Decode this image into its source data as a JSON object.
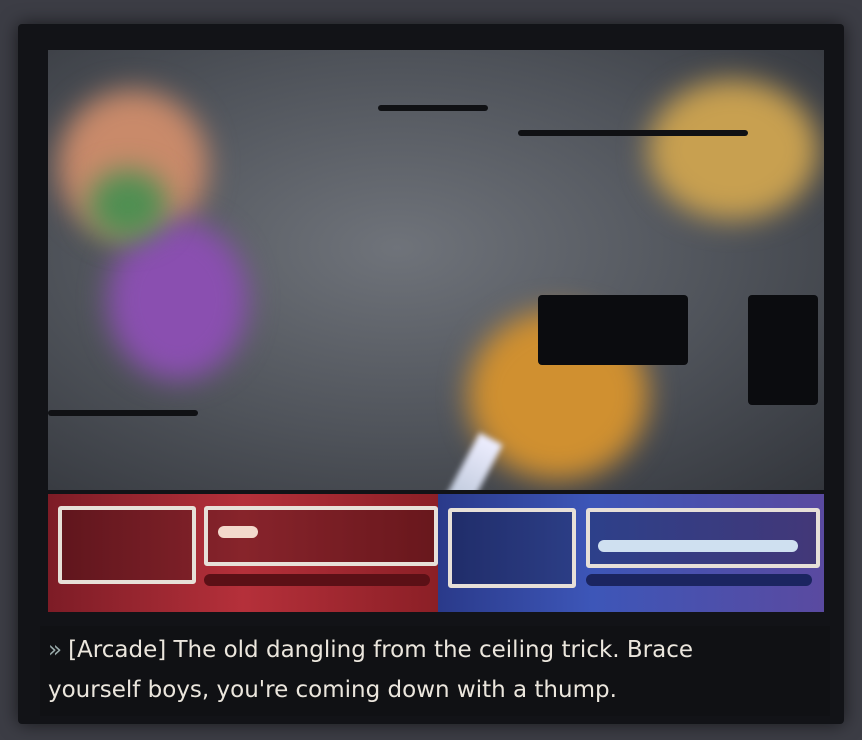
{
  "game": {
    "hud": {
      "player_color": "#b5303a",
      "enemy_color": "#3d56b8"
    },
    "subtitle": {
      "marker": "»",
      "line1": "[Arcade] The old dangling from the ceiling trick. Brace",
      "line2": "yourself boys, you're coming down with a thump."
    }
  }
}
